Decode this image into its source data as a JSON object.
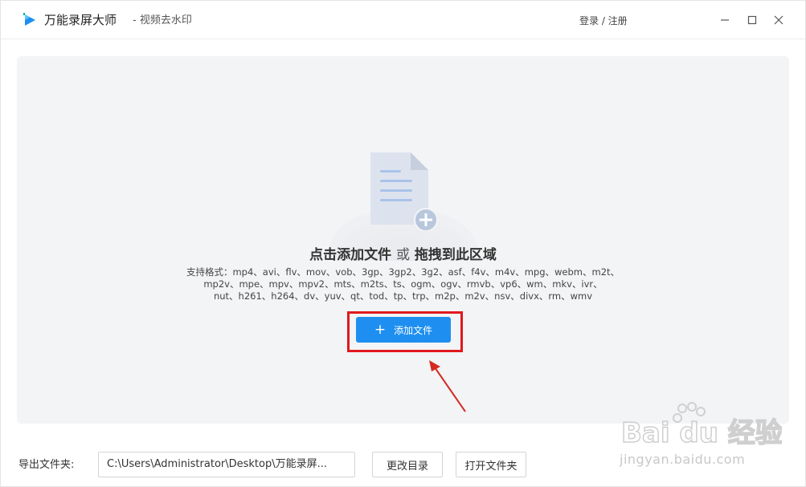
{
  "titlebar": {
    "app_name": "万能录屏大师",
    "subtitle": "- 视频去水印",
    "login": "登录 / 注册"
  },
  "dropzone": {
    "title_main": "点击添加文件",
    "title_or": "或",
    "title_drag": "拖拽到此区域",
    "formats_line1": "支持格式：mp4、avi、flv、mov、vob、3gp、3gp2、3g2、asf、f4v、m4v、mpg、webm、m2t、",
    "formats_line2": "mp2v、mpe、mpv、mpv2、mts、m2ts、ts、ogm、ogv、rmvb、vp6、wm、mkv、ivr、",
    "formats_line3": "nut、h261、h264、dv、yuv、qt、tod、tp、trp、m2p、m2v、nsv、divx、rm、wmv",
    "add_button": "添加文件"
  },
  "footer": {
    "export_label": "导出文件夹:",
    "path_value": "C:\\Users\\Administrator\\Desktop\\万能录屏...",
    "change_dir": "更改目录",
    "open_folder": "打开文件夹"
  },
  "watermark": {
    "logo_text": "Bai du 经验",
    "url": "jingyan.baidu.com"
  },
  "colors": {
    "accent": "#1e8ff0",
    "highlight": "#e0191d",
    "dropzone_bg": "#f3f4f6"
  },
  "icons": {
    "logo": "play-logo-icon",
    "minimize": "minimize-icon",
    "maximize": "maximize-icon",
    "close": "close-icon",
    "file": "document-add-icon",
    "arrow": "annotation-arrow-icon"
  }
}
